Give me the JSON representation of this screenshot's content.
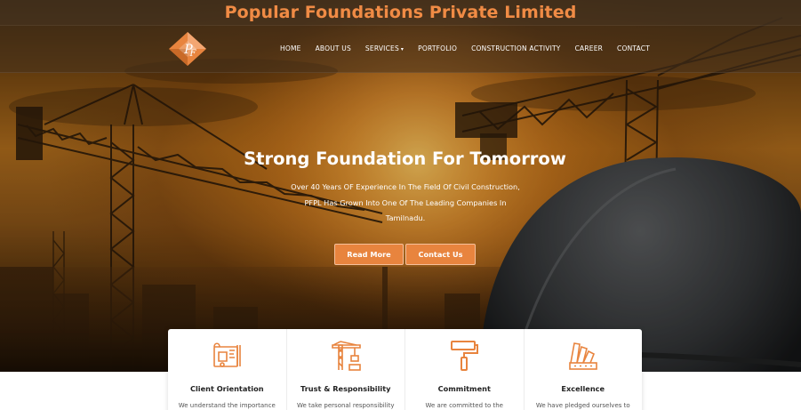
{
  "brand": {
    "title": "Popular Foundations Private Limited",
    "accent_color": "#f08b45",
    "logo_icon": "pf-diamond-logo"
  },
  "nav": {
    "items": [
      {
        "label": "HOME"
      },
      {
        "label": "ABOUT US"
      },
      {
        "label": "SERVICES",
        "has_dropdown": true
      },
      {
        "label": "PORTFOLIO"
      },
      {
        "label": "CONSTRUCTION ACTIVITY"
      },
      {
        "label": "CAREER"
      },
      {
        "label": "CONTACT"
      }
    ]
  },
  "hero": {
    "headline": "Strong Foundation For Tomorrow",
    "sub_line_1": "Over 40 Years OF Experience In The Field Of Civil Construction,",
    "sub_line_2": "PFPL Has Grown Into One Of The Leading Companies In",
    "sub_line_3": "Tamilnadu.",
    "read_more_label": "Read More",
    "contact_label": "Contact Us",
    "button_color": "#e8843e"
  },
  "features": [
    {
      "icon": "blueprint-tools-icon",
      "title": "Client Orientation",
      "text": "We understand the importance"
    },
    {
      "icon": "crane-icon",
      "title": "Trust & Responsibility",
      "text": "We take personal responsibility"
    },
    {
      "icon": "paint-roller-icon",
      "title": "Commitment",
      "text": "We are committed to the"
    },
    {
      "icon": "color-swatch-icon",
      "title": "Excellence",
      "text": "We have pledged ourselves to"
    }
  ]
}
